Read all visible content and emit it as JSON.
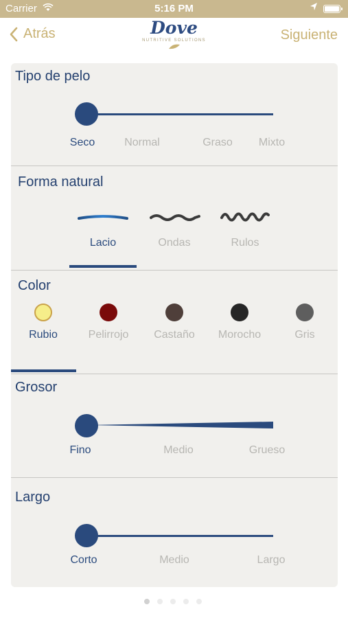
{
  "status_bar": {
    "carrier": "Carrier",
    "time": "5:16 PM"
  },
  "nav": {
    "back_label": "Atrás",
    "next_label": "Siguiente",
    "logo_brand": "Dove",
    "logo_sub": "NUTRITIVE SOLUTIONS"
  },
  "tipo_pelo": {
    "title": "Tipo de pelo",
    "options": [
      "Seco",
      "Normal",
      "Graso",
      "Mixto"
    ],
    "selected": "Seco"
  },
  "forma_natural": {
    "title": "Forma natural",
    "options": [
      "Lacio",
      "Ondas",
      "Rulos"
    ],
    "selected": "Lacio"
  },
  "color": {
    "title": "Color",
    "options": [
      {
        "label": "Rubio",
        "color": "#f6ee8a"
      },
      {
        "label": "Pelirrojo",
        "color": "#7a0a0a"
      },
      {
        "label": "Castaño",
        "color": "#4f3f3a"
      },
      {
        "label": "Morocho",
        "color": "#262626"
      },
      {
        "label": "Gris",
        "color": "#5e5e5e"
      }
    ],
    "selected": "Rubio"
  },
  "grosor": {
    "title": "Grosor",
    "options": [
      "Fino",
      "Medio",
      "Grueso"
    ],
    "selected": "Fino"
  },
  "largo": {
    "title": "Largo",
    "options": [
      "Corto",
      "Medio",
      "Largo"
    ],
    "selected": "Corto"
  },
  "pager": {
    "pages": 5,
    "current": 1
  },
  "colors": {
    "accent": "#2a4a7d",
    "nav_gold": "#c9b274",
    "status_bar": "#c9b88f"
  }
}
